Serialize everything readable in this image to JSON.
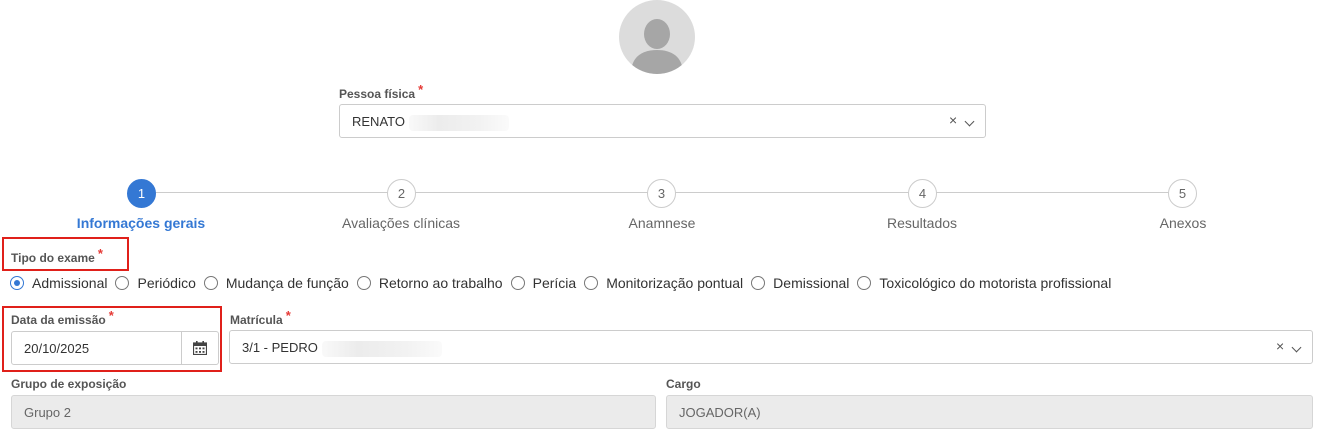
{
  "pessoa": {
    "label": "Pessoa física",
    "required_mark": "*",
    "value": "RENATO",
    "clear_symbol": "×"
  },
  "steps": [
    {
      "number": "1",
      "label": "Informações gerais",
      "active": true
    },
    {
      "number": "2",
      "label": "Avaliações clínicas",
      "active": false
    },
    {
      "number": "3",
      "label": "Anamnese",
      "active": false
    },
    {
      "number": "4",
      "label": "Resultados",
      "active": false
    },
    {
      "number": "5",
      "label": "Anexos",
      "active": false
    }
  ],
  "tipo_exame": {
    "label": "Tipo do exame",
    "required_mark": "*",
    "selected": "Admissional",
    "options": [
      "Admissional",
      "Periódico",
      "Mudança de função",
      "Retorno ao trabalho",
      "Perícia",
      "Monitorização pontual",
      "Demissional",
      "Toxicológico do motorista profissional"
    ]
  },
  "data_emissao": {
    "label": "Data da emissão",
    "required_mark": "*",
    "value": "20/10/2025",
    "icon": "calendar-icon"
  },
  "matricula": {
    "label": "Matrícula",
    "required_mark": "*",
    "value": "3/1 - PEDRO",
    "clear_symbol": "×"
  },
  "grupo_exposicao": {
    "label": "Grupo de exposição",
    "value": "Grupo 2"
  },
  "cargo": {
    "label": "Cargo",
    "value": "JOGADOR(A)"
  },
  "colors": {
    "accent": "#3478d4",
    "required": "#e53935",
    "highlight_box": "#e0201a"
  }
}
